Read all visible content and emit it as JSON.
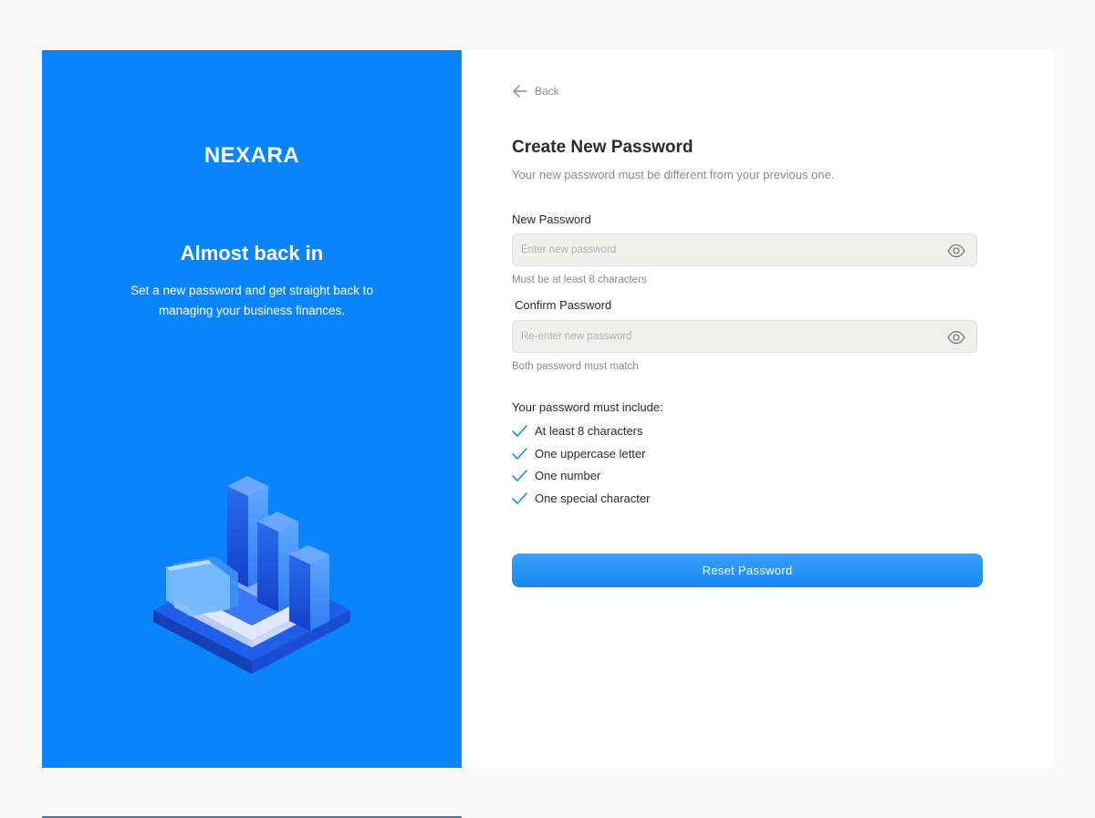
{
  "brand": {
    "name": "NEXARA"
  },
  "hero": {
    "title": "Almost back in",
    "text": "Set a new password and get straight back to managing your business finances."
  },
  "nav": {
    "back_label": "Back",
    "back_icon": "arrow-left-icon"
  },
  "form": {
    "title": "Create New Password",
    "subtitle": "Your new password must be different from your previous one.",
    "new_password": {
      "label": "New Password",
      "placeholder": "Enter new password",
      "value": "",
      "hint": "Must be at least 8 characters",
      "icon": "eye-icon"
    },
    "confirm_password": {
      "label": "Confirm Password",
      "placeholder": "Re-enter new password",
      "value": "",
      "hint": "Both password must match",
      "icon": "eye-icon"
    },
    "requirements_title": "Your password must include:",
    "requirements": [
      {
        "label": "At least 8 characters",
        "met": true
      },
      {
        "label": "One uppercase letter",
        "met": true
      },
      {
        "label": "One number",
        "met": true
      },
      {
        "label": "One special character",
        "met": true
      }
    ],
    "submit_label": "Reset Password"
  },
  "colors": {
    "brand_blue": "#0a84fb",
    "button_blue": "#1688f3",
    "check_blue": "#1a8cf0",
    "field_bg": "#efefed",
    "text_dark": "#2b2b2b",
    "text_muted": "#8a8a8a"
  }
}
